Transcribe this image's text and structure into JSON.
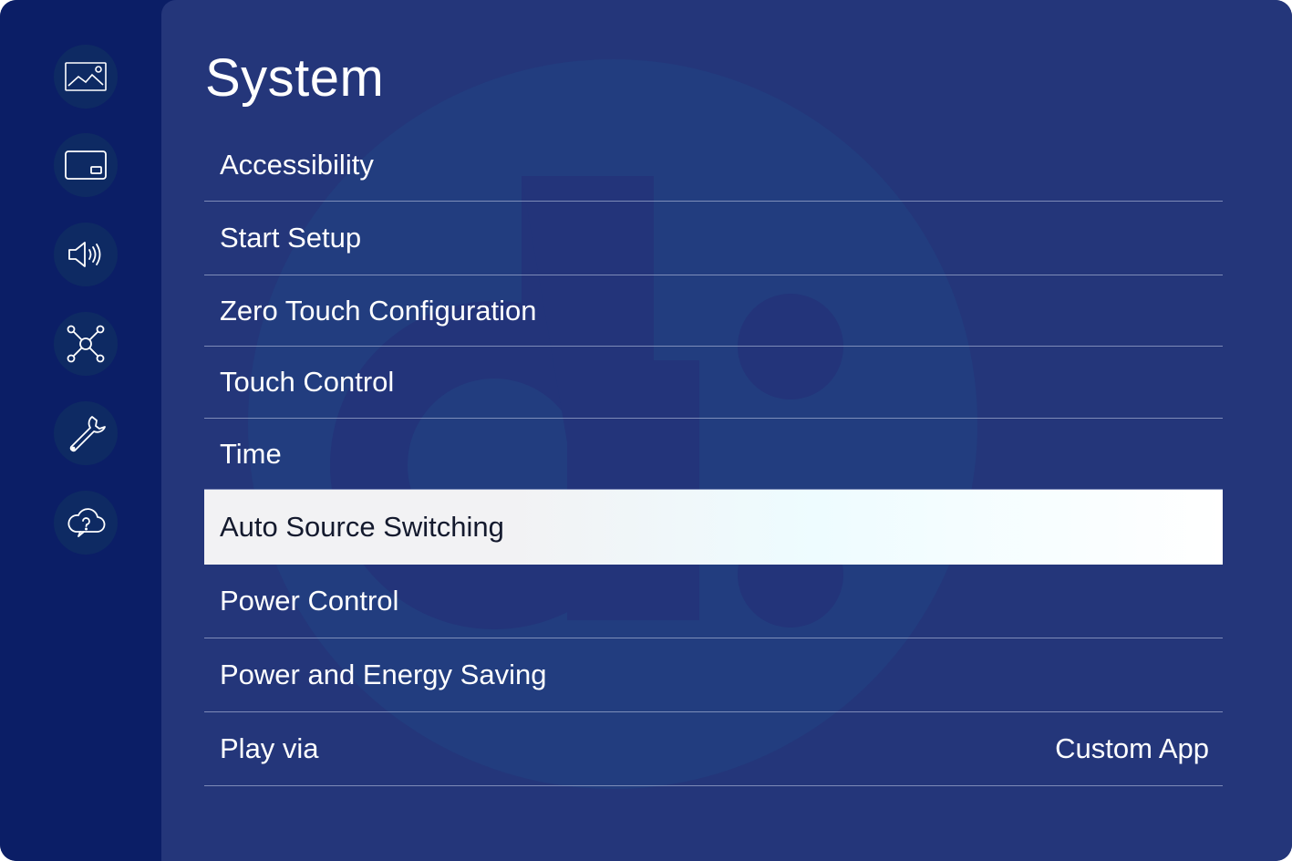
{
  "sidebar": {
    "items": [
      {
        "icon": "picture-icon"
      },
      {
        "icon": "screen-icon"
      },
      {
        "icon": "speaker-icon"
      },
      {
        "icon": "network-icon"
      },
      {
        "icon": "wrench-icon"
      },
      {
        "icon": "cloud-help-icon"
      }
    ]
  },
  "main": {
    "title": "System",
    "items": [
      {
        "label": "Accessibility",
        "value": ""
      },
      {
        "label": "Start Setup",
        "value": ""
      },
      {
        "label": "Zero Touch Configuration",
        "value": ""
      },
      {
        "label": "Touch Control",
        "value": ""
      },
      {
        "label": "Time",
        "value": ""
      },
      {
        "label": "Auto Source Switching",
        "value": "",
        "selected": true
      },
      {
        "label": "Power Control",
        "value": ""
      },
      {
        "label": "Power and Energy Saving",
        "value": ""
      },
      {
        "label": "Play via",
        "value": "Custom App"
      }
    ]
  },
  "colors": {
    "sidebar_bg": "#0b1e66",
    "panel_bg": "#24367a",
    "selected_bg": "#f2f2f4",
    "text": "#ffffff"
  }
}
